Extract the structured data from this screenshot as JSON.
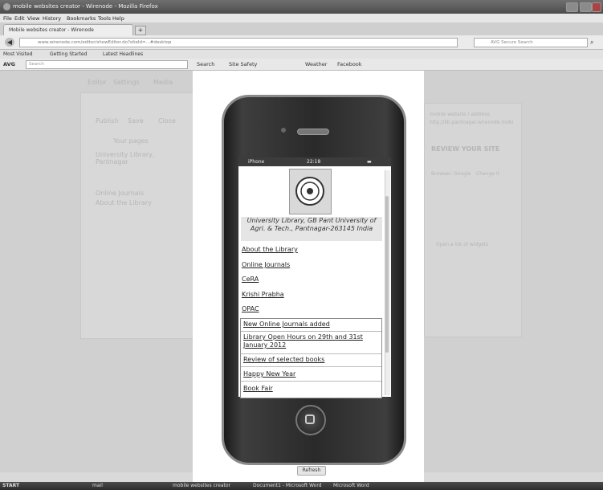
{
  "window": {
    "title": "mobile websites creator - Wirenode - Mozilla Firefox"
  },
  "menu": [
    "File",
    "Edit",
    "View",
    "History",
    "Bookmarks",
    "Tools",
    "Help"
  ],
  "tab": {
    "label": "Mobile websites creator - Wirenode",
    "new_tab": "+"
  },
  "nav": {
    "url": "www.wirenode.com/editor/showEditor.do?siteId=...#desktop",
    "search_placeholder": "AVG Secure Search"
  },
  "bookmarks": [
    "Most Visited",
    "Getting Started",
    "Latest Headlines"
  ],
  "avg": {
    "logo": "AVG",
    "search_placeholder": "Search",
    "search_btn": "Search",
    "site_safety": "Site Safety",
    "weather": "Weather",
    "facebook": "Facebook"
  },
  "editor": {
    "tabs": [
      "Editor",
      "Settings",
      "Media"
    ],
    "buttons": [
      "Publish",
      "Save",
      "Close"
    ],
    "pages_title": "Your pages",
    "pages": [
      "University Library, Pantnagar",
      "Online Journals",
      "About the Library"
    ]
  },
  "right_panel": {
    "text1": "mobile website / address",
    "text2": "http://lib.pantnagar.wirenode.mobi",
    "review": "REVIEW YOUR SITE",
    "browser": "Browser: Google",
    "change": "Change it",
    "open": "Open a list of widgets"
  },
  "phone": {
    "status": {
      "carrier": "iPhone",
      "time": "22:18"
    },
    "university": "University Library, GB Pant University of Agri. & Tech., Pantnagar-263145 India",
    "links": [
      "About the Library",
      "Online Journals",
      "CeRA",
      "Krishi Prabha",
      "OPAC"
    ],
    "news": [
      "New Online Journals added",
      "Library Open Hours on 29th and 31st January 2012",
      "Review of selected books",
      "Happy New Year",
      "Book Fair"
    ]
  },
  "refresh": "Refresh",
  "taskbar": {
    "start": "START",
    "items": [
      "mobile websites creator",
      "mail",
      "Document1 - Microsoft Word",
      "Microsoft Word"
    ]
  }
}
